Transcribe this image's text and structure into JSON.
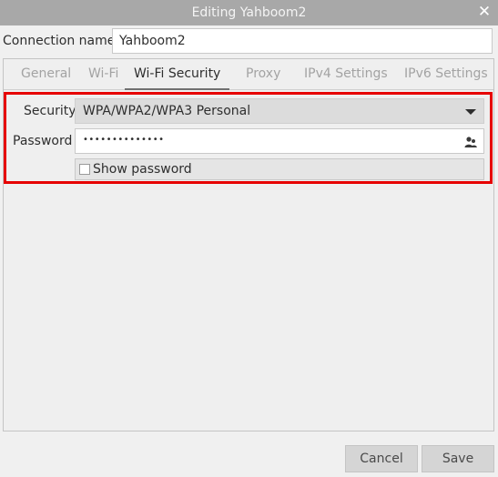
{
  "window": {
    "title": "Editing Yahboom2",
    "close_glyph": "✕"
  },
  "connection": {
    "label": "Connection name",
    "value": "Yahboom2"
  },
  "tabs": [
    {
      "label": "General",
      "active": false
    },
    {
      "label": "Wi-Fi",
      "active": false
    },
    {
      "label": "Wi-Fi Security",
      "active": true
    },
    {
      "label": "Proxy",
      "active": false
    },
    {
      "label": "IPv4 Settings",
      "active": false
    },
    {
      "label": "IPv6 Settings",
      "active": false
    }
  ],
  "security": {
    "label": "Security",
    "selected": "WPA/WPA2/WPA3 Personal"
  },
  "password": {
    "label": "Password",
    "masked_value": "••••••••••••••",
    "icon": "user-group-icon"
  },
  "show_password": {
    "label": "Show password",
    "checked": false
  },
  "buttons": {
    "cancel": "Cancel",
    "save": "Save"
  },
  "colors": {
    "highlight_border": "#e60000",
    "titlebar": "#a8a8a8"
  }
}
